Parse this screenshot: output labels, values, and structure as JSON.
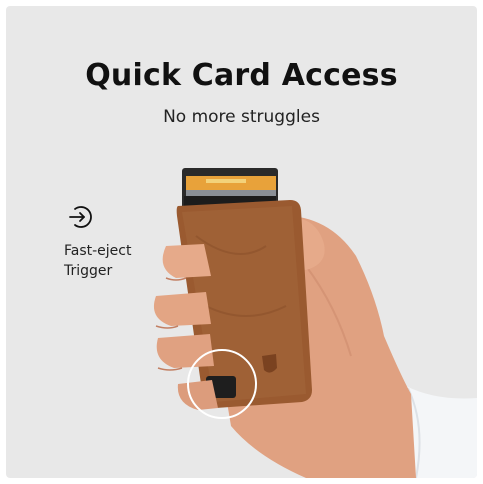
{
  "header": {
    "title": "Quick Card Access",
    "subtitle": "No more struggles"
  },
  "feature": {
    "icon": "eject-arrow-icon",
    "label_line1": "Fast-eject",
    "label_line2": "Trigger"
  },
  "colors": {
    "background": "#e8e8e8",
    "wallet_leather": "#9a5a30",
    "skin": "#e3a584",
    "sleeve": "#f4f6f8",
    "text": "#111111"
  }
}
